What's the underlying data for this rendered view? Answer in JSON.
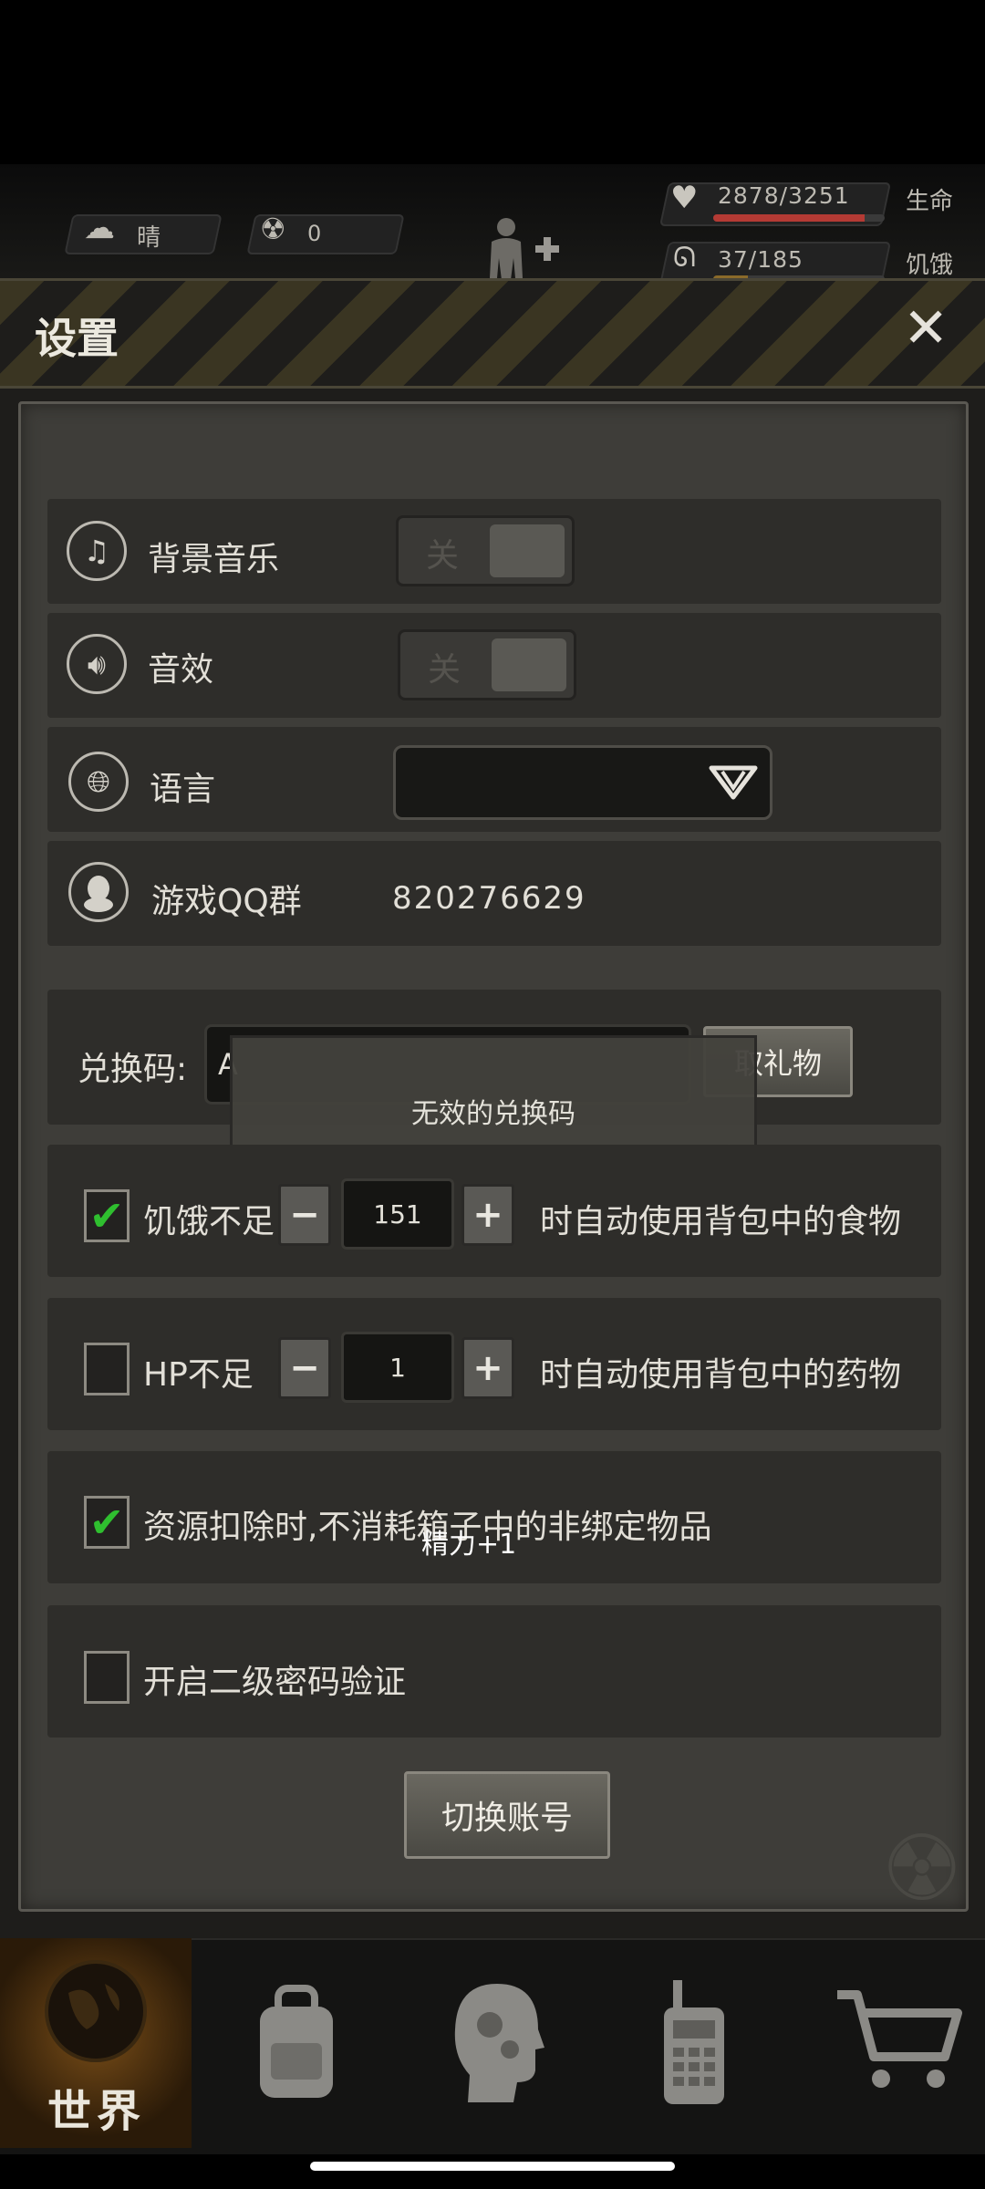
{
  "hud": {
    "weather_label": "晴",
    "radiation_value": "0",
    "hp_text": "2878/3251",
    "hp_label": "生命",
    "hp_fraction": 0.885,
    "hunger_text": "37/185",
    "hunger_label": "饥饿",
    "hunger_fraction": 0.2
  },
  "window": {
    "title": "设置"
  },
  "settings": {
    "music_label": "背景音乐",
    "music_toggle": "关",
    "sfx_label": "音效",
    "sfx_toggle": "关",
    "language_label": "语言",
    "language_value": "",
    "qq_label": "游戏QQ群",
    "qq_value": "820276629"
  },
  "redeem": {
    "label": "兑换码:",
    "input_value": "A",
    "button_label": "取礼物"
  },
  "toast": {
    "message": "无效的兑换码"
  },
  "auto_food": {
    "checked": true,
    "label": "饥饿不足",
    "value": "151",
    "suffix": "时自动使用背包中的食物"
  },
  "auto_medicine": {
    "checked": false,
    "label": "HP不足",
    "value": "1",
    "suffix": "时自动使用背包中的药物"
  },
  "resource_option": {
    "checked": true,
    "label": "资源扣除时,不消耗箱子中的非绑定物品"
  },
  "floating_text": "精力+1",
  "second_password": {
    "checked": false,
    "label": "开启二级密码验证"
  },
  "switch_account_label": "切换账号",
  "bottom_nav": {
    "world_label": "世界"
  },
  "colors": {
    "hp_bar": "#b43a34",
    "hunger_bar": "#8a6a2a",
    "check_green": "#2fbf2f"
  }
}
